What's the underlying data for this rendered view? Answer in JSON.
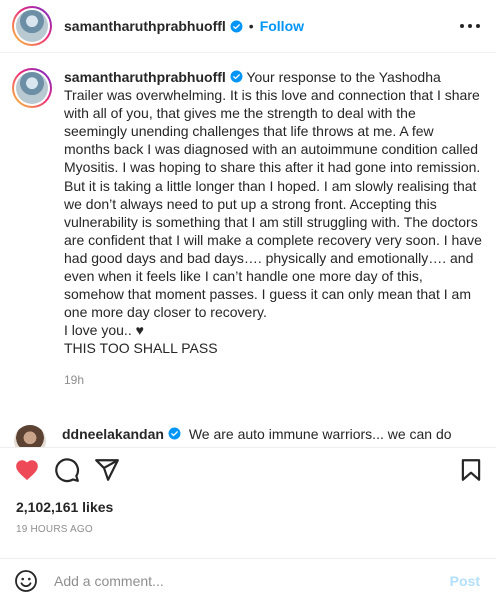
{
  "header": {
    "username": "samantharuthprabhuoffl",
    "separator": "•",
    "follow_label": "Follow"
  },
  "caption": {
    "username": "samantharuthprabhuoffl",
    "text": "Your response to the Yashodha Trailer was overwhelming. It is this love and connection that I share with all of you, that gives me the strength to deal with the seemingly unending challenges that life throws at me. A few months back I was diagnosed with an autoimmune condition called Myositis. I was hoping to share this after it had gone into remission. But it is taking a little longer than I hoped. I am slowly realising that we don’t always need to put up a strong front. Accepting this vulnerability is something that I am still struggling with. The doctors are confident that I will make a complete recovery very soon. I have had good days and bad days…. physically and emotionally…. and even when it feels like I can’t handle one more day of this, somehow that moment passes. I guess it can only mean that I am one more day closer to recovery.\nI love you.. ♥\nTHIS TOO SHALL PASS",
    "time": "19h"
  },
  "comment": {
    "username": "ddneelakandan",
    "text": "We are auto immune warriors... we can do"
  },
  "likes": "2,102,161 likes",
  "posted": "19 HOURS AGO",
  "comment_box": {
    "placeholder": "Add a comment...",
    "post_label": "Post"
  },
  "icons": [
    "heart-icon",
    "comment-icon",
    "share-icon",
    "bookmark-icon",
    "emoji-icon",
    "more-icon",
    "verified-icon"
  ],
  "colors": {
    "heart": "#ed4956",
    "follow": "#0095f6",
    "post_disabled": "#b2dffc",
    "muted": "#8e8e8e"
  }
}
